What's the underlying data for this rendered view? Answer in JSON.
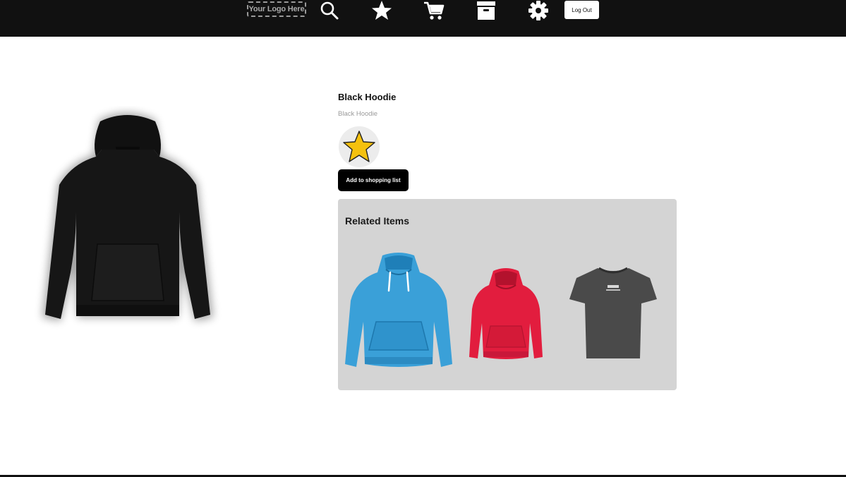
{
  "header": {
    "logo_text": "Your Logo Here",
    "nav_icons": [
      "search-icon",
      "star-icon",
      "cart-icon",
      "archive-icon",
      "gear-icon"
    ],
    "logout_label": "Log Out"
  },
  "product": {
    "title": "Black Hoodie",
    "subtitle": "Black Hoodie",
    "favorite_icon": "star-icon",
    "favorite_color": "#f5c10e",
    "add_button_label": "Add to shopping list"
  },
  "related": {
    "title": "Related Items",
    "items": [
      {
        "name": "blue-hoodie",
        "color": "#3aa0d8"
      },
      {
        "name": "red-hoodie",
        "color": "#e21d3e"
      },
      {
        "name": "grey-tshirt",
        "color": "#4a4a4a"
      }
    ]
  },
  "colors": {
    "topbar": "#111111",
    "panel": "#d4d4d4",
    "button": "#000000"
  }
}
